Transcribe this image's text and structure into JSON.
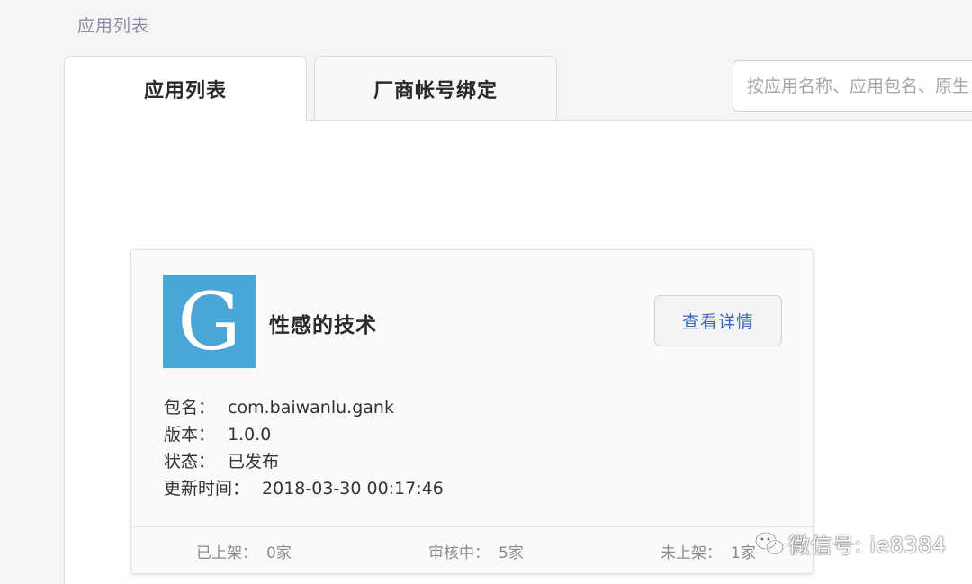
{
  "breadcrumb": "应用列表",
  "tabs": [
    {
      "label": "应用列表",
      "active": true
    },
    {
      "label": "厂商帐号绑定",
      "active": false
    }
  ],
  "search": {
    "placeholder": "按应用名称、应用包名、原生"
  },
  "app": {
    "icon_letter": "G",
    "icon_color": "#4aa6d6",
    "name": "性感的技术",
    "detail_button": "查看详情",
    "fields": [
      {
        "label": "包名：",
        "value": "com.baiwanlu.gank"
      },
      {
        "label": "版本：",
        "value": "1.0.0"
      },
      {
        "label": "状态：",
        "value": "已发布"
      },
      {
        "label": "更新时间：",
        "value": "2018-03-30 00:17:46"
      }
    ],
    "stats": [
      {
        "label": "已上架：",
        "value": "0家"
      },
      {
        "label": "审核中：",
        "value": "5家"
      },
      {
        "label": "未上架：",
        "value": "1家"
      }
    ]
  },
  "watermark": {
    "text": "微信号: ie8384",
    "icon": "wechat-icon"
  },
  "colors": {
    "accent_link": "#3f68c4",
    "icon_bg": "#4aa6d6"
  }
}
